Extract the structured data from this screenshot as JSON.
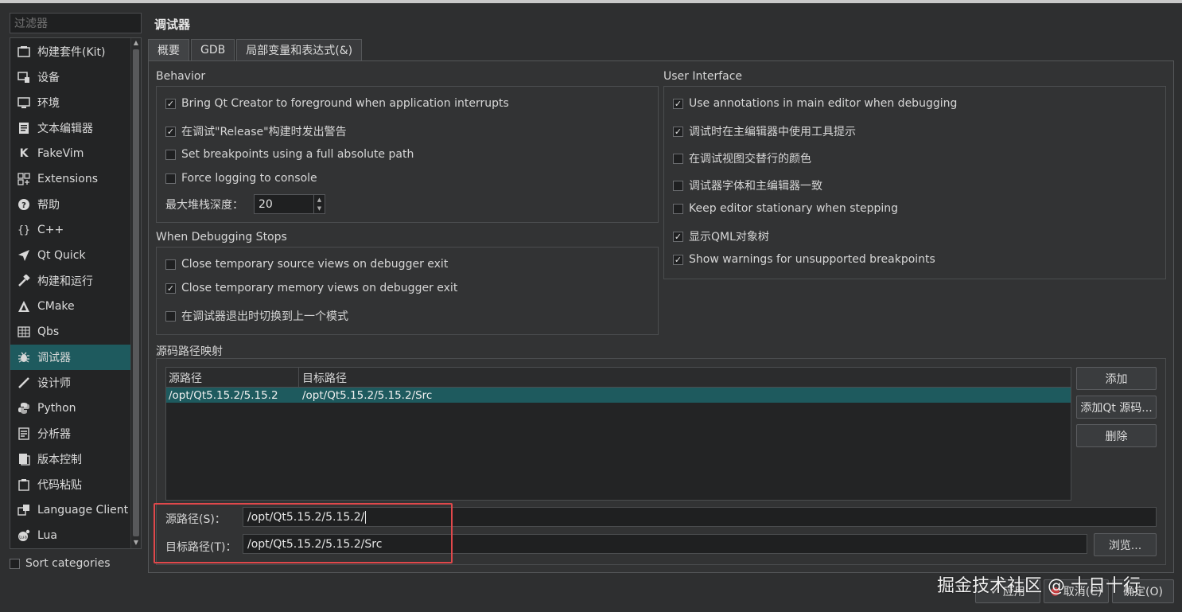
{
  "filter": {
    "placeholder": "过滤器"
  },
  "sidebar": {
    "items": [
      {
        "label": "构建套件(Kit)",
        "icon": "kit-icon"
      },
      {
        "label": "设备",
        "icon": "device-icon"
      },
      {
        "label": "环境",
        "icon": "monitor-icon"
      },
      {
        "label": "文本编辑器",
        "icon": "text-editor-icon"
      },
      {
        "label": "FakeVim",
        "icon": "fakevim-icon"
      },
      {
        "label": "Extensions",
        "icon": "extensions-icon"
      },
      {
        "label": "帮助",
        "icon": "help-icon"
      },
      {
        "label": "C++",
        "icon": "braces-icon"
      },
      {
        "label": "Qt Quick",
        "icon": "qtquick-icon"
      },
      {
        "label": "构建和运行",
        "icon": "hammer-icon"
      },
      {
        "label": "CMake",
        "icon": "cmake-icon"
      },
      {
        "label": "Qbs",
        "icon": "qbs-icon"
      },
      {
        "label": "调试器",
        "icon": "bug-icon",
        "selected": true
      },
      {
        "label": "设计师",
        "icon": "pencil-icon"
      },
      {
        "label": "Python",
        "icon": "python-icon"
      },
      {
        "label": "分析器",
        "icon": "analyzer-icon"
      },
      {
        "label": "版本控制",
        "icon": "version-control-icon"
      },
      {
        "label": "代码粘贴",
        "icon": "clipboard-icon"
      },
      {
        "label": "Language Client",
        "icon": "language-client-icon"
      },
      {
        "label": "Lua",
        "icon": "lua-icon"
      }
    ],
    "sort_categories": {
      "label": "Sort categories",
      "checked": false
    }
  },
  "page": {
    "title": "调试器",
    "tabs": [
      {
        "label": "概要",
        "active": true
      },
      {
        "label": "GDB",
        "active": false
      },
      {
        "label": "局部变量和表达式(&)",
        "active": false
      }
    ]
  },
  "behavior": {
    "title": "Behavior",
    "options": [
      {
        "label": "Bring Qt Creator to foreground when application interrupts",
        "checked": true
      },
      {
        "label": "在调试\"Release\"构建时发出警告",
        "checked": true
      },
      {
        "label": "Set breakpoints using a full absolute path",
        "checked": false
      },
      {
        "label": "Force logging to console",
        "checked": false
      }
    ],
    "max_stack_depth": {
      "label": "最大堆栈深度：",
      "value": "20"
    }
  },
  "debug_stops": {
    "title": "When Debugging Stops",
    "options": [
      {
        "label": "Close temporary source views on debugger exit",
        "checked": false
      },
      {
        "label": "Close temporary memory views on debugger exit",
        "checked": true
      },
      {
        "label": "在调试器退出时切换到上一个模式",
        "checked": false
      }
    ]
  },
  "user_interface": {
    "title": "User Interface",
    "options": [
      {
        "label": "Use annotations in main editor when debugging",
        "checked": true
      },
      {
        "label": "调试时在主编辑器中使用工具提示",
        "checked": true
      },
      {
        "label": "在调试视图交替行的颜色",
        "checked": false
      },
      {
        "label": "调试器字体和主编辑器一致",
        "checked": false
      },
      {
        "label": "Keep editor stationary when stepping",
        "checked": false
      },
      {
        "label": "显示QML对象树",
        "checked": true
      },
      {
        "label": "Show warnings for unsupported breakpoints",
        "checked": true
      }
    ]
  },
  "source_mapping": {
    "title": "源码路径映射",
    "columns": [
      "源路径",
      "目标路径"
    ],
    "rows": [
      {
        "source": "/opt/Qt5.15.2/5.15.2",
        "target": "/opt/Qt5.15.2/5.15.2/Src"
      }
    ],
    "buttons": {
      "add": "添加",
      "add_qt": "添加Qt 源码...",
      "remove": "删除",
      "browse": "浏览..."
    },
    "source_field": {
      "label": "源路径(S)：",
      "value": "/opt/Qt5.15.2/5.15.2/"
    },
    "target_field": {
      "label": "目标路径(T)：",
      "value": "/opt/Qt5.15.2/5.15.2/Src"
    }
  },
  "footer": {
    "apply": "应用",
    "cancel": "取消(C)",
    "ok": "确定(O)",
    "watermark": "掘金技术社区 @ 十日十行"
  },
  "colors": {
    "accent": "#1e5a5e",
    "highlight_box": "#e0484b",
    "background": "#2e2f30"
  }
}
